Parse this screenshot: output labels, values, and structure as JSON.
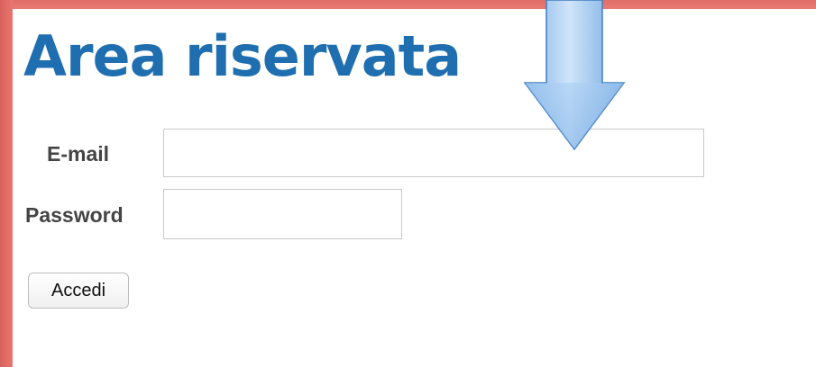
{
  "page": {
    "title": "Area riservata"
  },
  "form": {
    "email_label": "E-mail",
    "email_value": "",
    "password_label": "Password",
    "password_value": "",
    "submit_label": "Accedi"
  },
  "overlay": {
    "arrow_icon": "down-arrow-icon",
    "arrow_color": "#8fc0f0"
  },
  "colors": {
    "frame": "#e8726d",
    "title": "#1f6fb0",
    "label": "#444444"
  }
}
